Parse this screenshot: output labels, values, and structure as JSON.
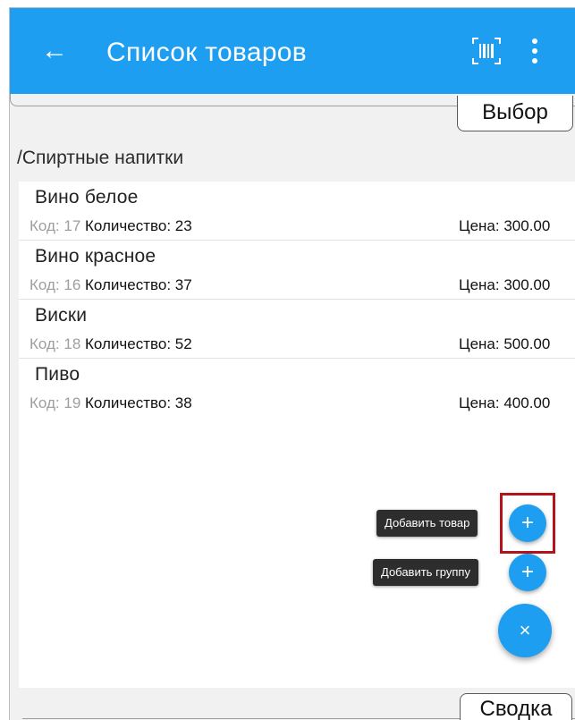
{
  "appbar": {
    "title": "Список товаров",
    "back_icon": "arrow-left-icon",
    "barcode_icon": "barcode-scan-icon",
    "menu_icon": "more-vert-icon",
    "color": "#1e9ef0"
  },
  "tabs": {
    "select_label": "Выбор",
    "summary_label": "Сводка"
  },
  "breadcrumb": "/Спиртные напитки",
  "products": [
    {
      "name": "Вино белое",
      "code_label": "Код:",
      "code": "17",
      "qty_label": "Количество:",
      "qty": "23",
      "price_label": "Цена:",
      "price": "300.00"
    },
    {
      "name": "Вино красное",
      "code_label": "Код:",
      "code": "16",
      "qty_label": "Количество:",
      "qty": "37",
      "price_label": "Цена:",
      "price": "300.00"
    },
    {
      "name": "Виски",
      "code_label": "Код:",
      "code": "18",
      "qty_label": "Количество:",
      "qty": "52",
      "price_label": "Цена:",
      "price": "500.00"
    },
    {
      "name": "Пиво",
      "code_label": "Код:",
      "code": "19",
      "qty_label": "Количество:",
      "qty": "38",
      "price_label": "Цена:",
      "price": "400.00"
    }
  ],
  "fab": {
    "add_product_label": "Добавить товар",
    "add_group_label": "Добавить группу",
    "plus_icon": "plus-icon",
    "close_icon": "close-icon",
    "highlight_color": "#b3141a"
  }
}
